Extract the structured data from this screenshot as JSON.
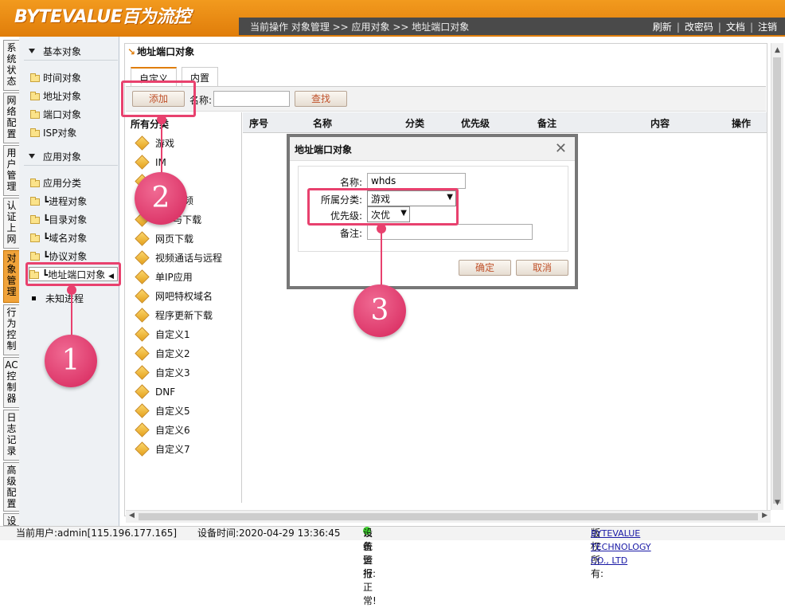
{
  "app": {
    "logo": "BYTEVALUE百为流控",
    "breadcrumb": "当前操作 对象管理 >> 应用对象 >> 地址端口对象",
    "toplinks": [
      "刷新",
      "改密码",
      "文档",
      "注销"
    ]
  },
  "vtabs": [
    "系统状态",
    "网络配置",
    "用户管理",
    "认证上网",
    "对象管理",
    "行为控制",
    "AC控制器",
    "日志记录",
    "高级配置",
    "设"
  ],
  "tree": {
    "group1": "基本对象",
    "group1_items": [
      "时间对象",
      "地址对象",
      "端口对象",
      "ISP对象"
    ],
    "group2": "应用对象",
    "group2_items": [
      "应用分类",
      "┗进程对象",
      "┗目录对象",
      "┗域名对象",
      "┗协议对象",
      "┗地址端口对象"
    ],
    "unknown": "未知进程"
  },
  "main": {
    "title": "地址端口对象",
    "tabs": [
      "自定义",
      "内置"
    ],
    "add_button": "添加",
    "name_label": "名称:",
    "search_button": "查找",
    "cat_header": "所有分类",
    "categories": [
      "游戏",
      "IM",
      "网页",
      "网页视频",
      "P2P与下载",
      "网页下载",
      "视频通话与远程",
      "单IP应用",
      "网吧特权域名",
      "程序更新下载",
      "自定义1",
      "自定义2",
      "自定义3",
      "DNF",
      "自定义5",
      "自定义6",
      "自定义7"
    ],
    "columns": [
      "序号",
      "名称",
      "分类",
      "优先级",
      "备注",
      "内容",
      "操作"
    ]
  },
  "dialog": {
    "title": "地址端口对象",
    "name_label": "名称:",
    "name_value": "whds",
    "category_label": "所属分类:",
    "category_value": "游戏",
    "priority_label": "优先级:",
    "priority_value": "次优",
    "note_label": "备注:",
    "ok": "确定",
    "cancel": "取消"
  },
  "annotations": [
    "1",
    "2",
    "3"
  ],
  "footer": {
    "user": "当前用户:admin[115.196.177.165]",
    "time": "设备时间:2020-04-29 13:36:45",
    "alert_label": "系统警报:",
    "alert_value": "设备运行正常!",
    "copyright_label": "版权所有:",
    "copyright_value": "BYTEVALUE TECHNOLOGY CO., LTD"
  }
}
